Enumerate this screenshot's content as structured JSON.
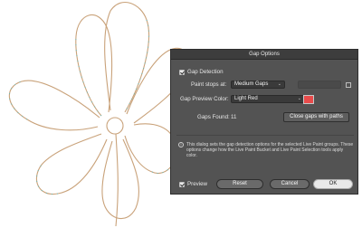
{
  "dialog": {
    "title": "Gap Options",
    "gap_detection": {
      "label": "Gap Detection",
      "checked": true
    },
    "paint_stops": {
      "label": "Paint stops at:",
      "value": "Medium Gaps"
    },
    "preview_color": {
      "label": "Gap Preview Color:",
      "value": "Light Red",
      "swatch": "#e94b4b"
    },
    "gaps_found": {
      "label": "Gaps Found:",
      "value": "11"
    },
    "close_gaps_button": "Close gaps with paths",
    "info_text": "This dialog sets the gap detection options for the selected Live Paint groups. These options change how the Live Paint Bucket and Live Paint Selection tools apply color.",
    "preview": {
      "label": "Preview",
      "checked": true
    },
    "reset_button": "Reset",
    "cancel_button": "Cancel",
    "ok_button": "OK"
  },
  "canvas": {
    "stroke_color": "#c9a27a",
    "gap_color": "#5bbcc0"
  }
}
